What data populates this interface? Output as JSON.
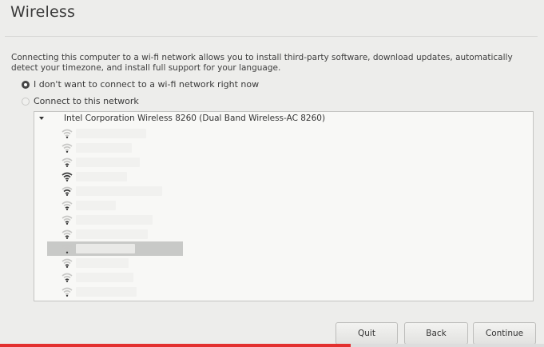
{
  "page": {
    "title": "Wireless",
    "description": "Connecting this computer to a wi-fi network allows you to install third-party software, download updates, automatically detect your timezone, and install full support for your language."
  },
  "options": {
    "no_connect_label": "I don't want to connect to a wi-fi network right now",
    "connect_label": "Connect to this network",
    "selected": "no_connect"
  },
  "network_list": {
    "adapter_name": "Intel Corporation Wireless 8260 (Dual Band Wireless-AC 8260)",
    "networks": [
      {
        "name": "",
        "signal": 1,
        "name_width": 88
      },
      {
        "name": "",
        "signal": 1,
        "name_width": 70
      },
      {
        "name": "",
        "signal": 2,
        "name_width": 80
      },
      {
        "name": "",
        "signal": 4,
        "name_width": 64
      },
      {
        "name": "",
        "signal": 3,
        "name_width": 108
      },
      {
        "name": "",
        "signal": 2,
        "name_width": 50
      },
      {
        "name": "",
        "signal": 2,
        "name_width": 96
      },
      {
        "name": "",
        "signal": 2,
        "name_width": 90
      },
      {
        "name": "",
        "signal": 1,
        "name_width": 74,
        "selected": true
      },
      {
        "name": "",
        "signal": 2,
        "name_width": 66
      },
      {
        "name": "",
        "signal": 2,
        "name_width": 72
      },
      {
        "name": "",
        "signal": 1,
        "name_width": 76
      }
    ]
  },
  "buttons": {
    "quit": "Quit",
    "back": "Back",
    "continue": "Continue"
  },
  "progress": {
    "fraction": 0.645
  },
  "icons": {
    "network": "wifi-signal-icon",
    "expander": "triangle-down-icon"
  }
}
